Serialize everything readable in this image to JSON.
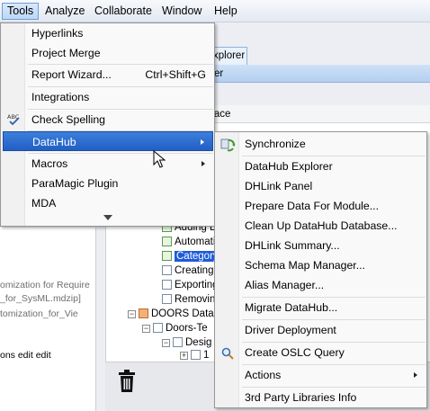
{
  "menubar": {
    "items": [
      {
        "label": "Tools",
        "mnemonic": "T",
        "active": true
      },
      {
        "label": "Analyze",
        "mnemonic": "A"
      },
      {
        "label": "Collaborate",
        "mnemonic": "C"
      },
      {
        "label": "Window",
        "mnemonic": "W"
      },
      {
        "label": "Help",
        "mnemonic": "H"
      }
    ]
  },
  "background": {
    "tab_label": "xplorer",
    "blue_strip_text": "er",
    "trace_label": "race",
    "left_panel_lines": [
      "omization for Require",
      "_for_SysML.mdzip]",
      "tomization_for_Vie",
      "ons edit edit"
    ],
    "tree": [
      {
        "text": "Adding E",
        "icon": "green-check-icon"
      },
      {
        "text": "Automati",
        "icon": "green-check-icon"
      },
      {
        "text": "Category",
        "icon": "green-check-icon",
        "selected": true
      },
      {
        "text": "Creating",
        "icon": "document-icon"
      },
      {
        "text": "Exporting",
        "icon": "document-icon"
      },
      {
        "text": "Removing",
        "icon": "document-icon"
      },
      {
        "text": "DOORS Data",
        "icon": "doors-icon"
      },
      {
        "text": "Doors-Te",
        "icon": "folder-icon"
      },
      {
        "text": "Desig",
        "icon": "list-icon"
      },
      {
        "text": "1",
        "icon": "list-icon"
      }
    ],
    "tree_expanders": [
      "−",
      "−",
      "−",
      "+"
    ]
  },
  "tools_menu": {
    "items": [
      {
        "label": "Hyperlinks"
      },
      {
        "label": "Project Merge"
      },
      {
        "label": "Report Wizard...",
        "shortcut": "Ctrl+Shift+G"
      },
      {
        "label": "Integrations"
      },
      {
        "label": "Check Spelling",
        "icon": "spell-check-icon"
      },
      {
        "label": "DataHub",
        "submenu": true,
        "highlighted": true
      },
      {
        "label": "Macros",
        "submenu": true
      },
      {
        "label": "ParaMagic Plugin"
      },
      {
        "label": "MDA"
      }
    ]
  },
  "datahub_menu": {
    "items": [
      {
        "label": "Synchronize",
        "icon": "sync-icon"
      },
      {
        "label": "DataHub Explorer"
      },
      {
        "label": "DHLink Panel"
      },
      {
        "label": "Prepare Data For Module..."
      },
      {
        "label": "Clean Up DataHub Database..."
      },
      {
        "label": "DHLink Summary..."
      },
      {
        "label": "Schema Map Manager..."
      },
      {
        "label": "Alias Manager..."
      },
      {
        "label": "Migrate DataHub..."
      },
      {
        "label": "Driver Deployment"
      },
      {
        "label": "Create OSLC Query",
        "icon": "search-icon"
      },
      {
        "label": "Actions",
        "submenu": true
      },
      {
        "label": "3rd Party Libraries Info"
      }
    ]
  },
  "colors": {
    "highlight": "#2a6bd1",
    "selection": "#1e5bd8"
  }
}
